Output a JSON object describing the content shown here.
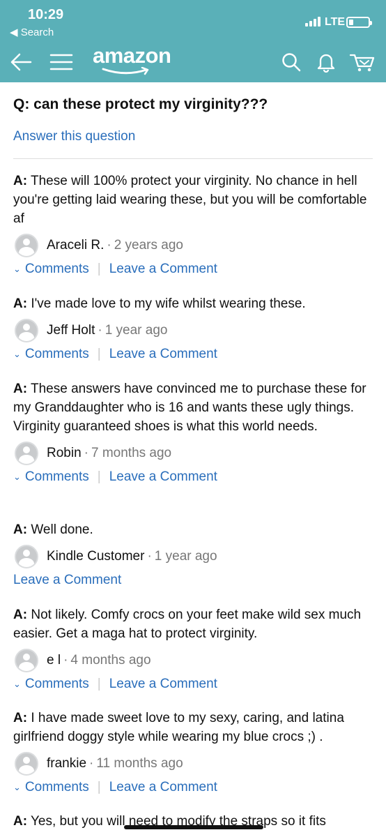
{
  "status": {
    "time": "10:29",
    "back_app": "Search",
    "network": "LTE"
  },
  "nav": {
    "logo": "amazon"
  },
  "question": {
    "label": "Q:",
    "text": "can these protect my virginity???",
    "answer_link": "Answer this question"
  },
  "answers": [
    {
      "label": "A:",
      "text": "These will 100% protect your virginity. No chance in hell you're getting laid wearing these, but you will be comfortable af",
      "author": "Araceli R.",
      "ago": "2 years ago",
      "comments": "Comments",
      "leave": "Leave a Comment"
    },
    {
      "label": "A:",
      "text": "I've made love to my wife whilst wearing these.",
      "author": "Jeff Holt",
      "ago": "1 year ago",
      "comments": "Comments",
      "leave": "Leave a Comment"
    },
    {
      "label": "A:",
      "text": "These answers have convinced me to purchase these for my Granddaughter who is 16 and wants these ugly things. Virginity guaranteed shoes is what this world needs.",
      "author": "Robin",
      "ago": "7 months ago",
      "comments": "Comments",
      "leave": "Leave a Comment"
    },
    {
      "label": "A:",
      "text": "Well done.",
      "author": "Kindle Customer",
      "ago": "1 year ago",
      "leave": "Leave a Comment"
    },
    {
      "label": "A:",
      "text": "Not likely. Comfy crocs on your feet make wild sex much easier. Get a maga hat to protect virginity.",
      "author": "e l",
      "ago": "4 months ago",
      "comments": "Comments",
      "leave": "Leave a Comment"
    },
    {
      "label": "A:",
      "text": "I have made sweet love to my sexy, caring, and latina girlfriend doggy style while wearing my blue crocs ;) .",
      "author": "frankie",
      "ago": "11 months ago",
      "comments": "Comments",
      "leave": "Leave a Comment"
    },
    {
      "label": "A:",
      "text": "Yes, but you will need to modify the straps so it fits"
    }
  ],
  "colors": {
    "header": "#5ab0b8",
    "link": "#2a6ebb"
  }
}
